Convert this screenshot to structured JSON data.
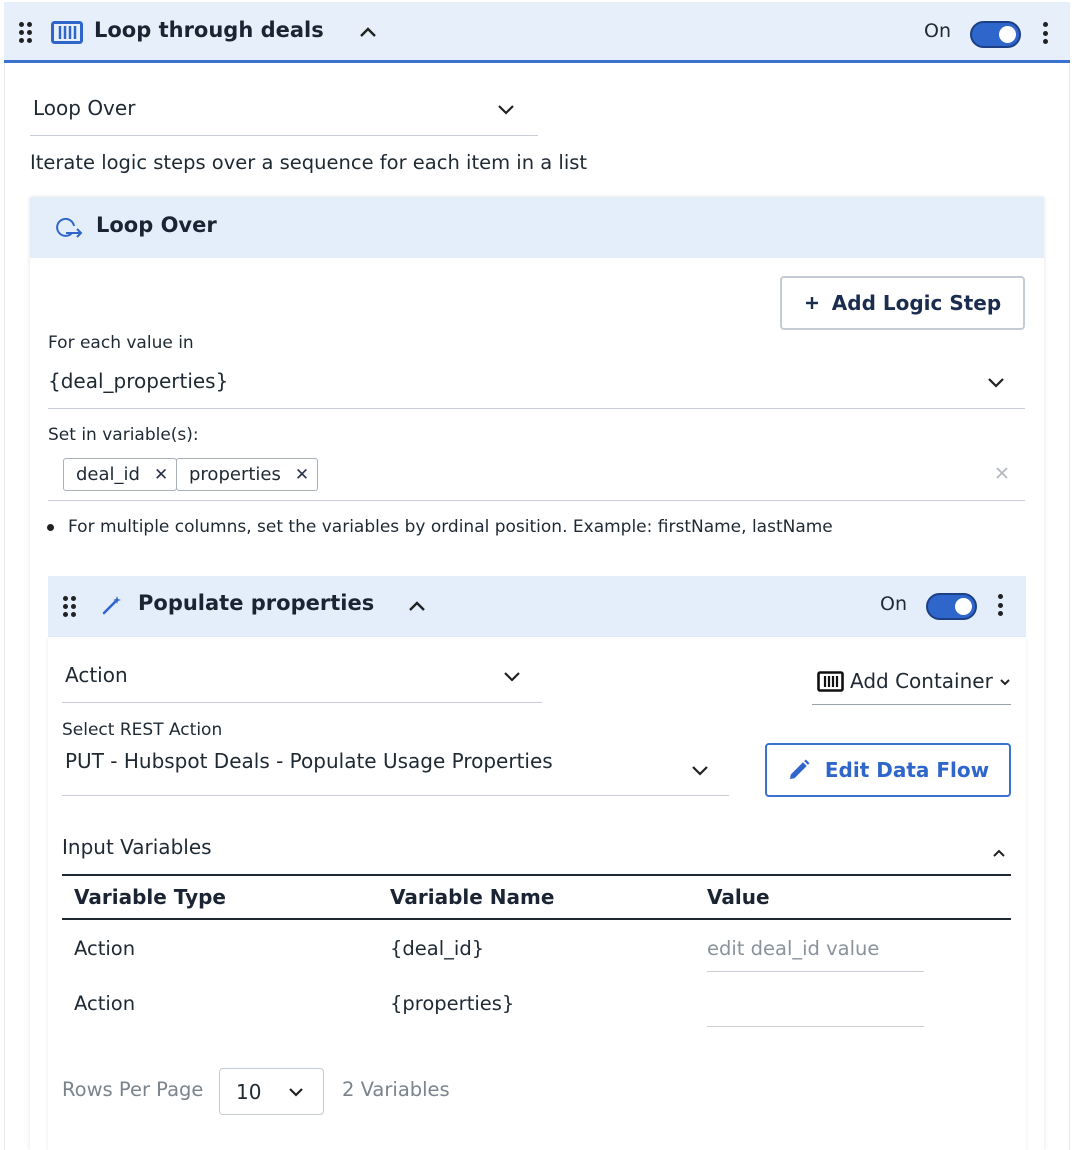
{
  "loop_block": {
    "title": "Loop through deals",
    "toggle_label": "On",
    "toggle_on": true,
    "icon": "container-icon"
  },
  "step_type": {
    "selected": "Loop Over",
    "description": "Iterate logic steps over a sequence for each item in a list"
  },
  "loop_over": {
    "title": "Loop Over",
    "add_step_label": "Add Logic Step",
    "for_each_label": "For each value in",
    "for_each_value": "{deal_properties}",
    "set_vars_label": "Set in variable(s):",
    "variables": [
      "deal_id",
      "properties"
    ],
    "hint": "For multiple columns, set the variables by ordinal position. Example: firstName, lastName"
  },
  "populate_step": {
    "title": "Populate properties",
    "toggle_label": "On",
    "toggle_on": true,
    "step_type": "Action",
    "add_container_label": "Add Container",
    "rest_action_label": "Select REST Action",
    "rest_action_value": "PUT - Hubspot Deals - Populate Usage Properties",
    "edit_flow_label": "Edit Data Flow",
    "input_vars_title": "Input Variables",
    "columns": [
      "Variable Type",
      "Variable Name",
      "Value"
    ],
    "rows": [
      {
        "type": "Action",
        "name": "{deal_id}",
        "value": "",
        "placeholder": "edit deal_id value"
      },
      {
        "type": "Action",
        "name": "{properties}",
        "value": "",
        "placeholder": ""
      }
    ],
    "pager": {
      "rows_per_page_label": "Rows Per Page",
      "rows_per_page": "10",
      "count_label": "2 Variables"
    }
  },
  "colors": {
    "accent": "#2f66cc",
    "header_bg": "#e7f0fa",
    "text": "#1f2933"
  }
}
